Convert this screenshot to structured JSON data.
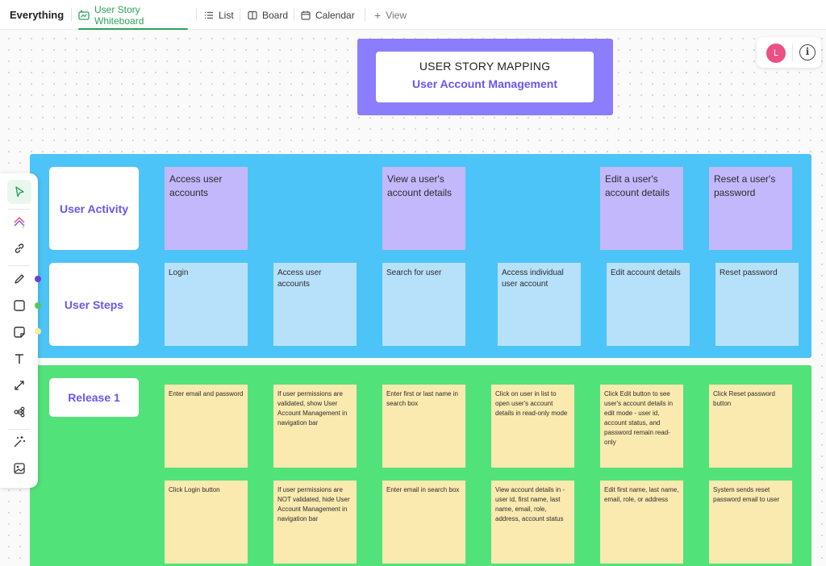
{
  "nav": {
    "breadcrumb": "Everything",
    "tabs": [
      {
        "label": "User Story Whiteboard",
        "icon": "whiteboard-icon",
        "active": true
      },
      {
        "label": "List",
        "icon": "list-icon"
      },
      {
        "label": "Board",
        "icon": "board-icon"
      },
      {
        "label": "Calendar",
        "icon": "calendar-icon"
      },
      {
        "label": "View",
        "icon": "plus-icon"
      }
    ]
  },
  "header_card": {
    "title": "USER STORY MAPPING",
    "subtitle": "User Account Management"
  },
  "user": {
    "avatar_initial": "L",
    "avatar_color": "#ec4f84",
    "info_symbol": "i"
  },
  "colors": {
    "accent": "#2aa45a",
    "title_card": "#8b7dfb",
    "lane_blue": "#4cc4f7",
    "lane_green": "#52e27a",
    "sticky_purple": "#c3b8fb",
    "sticky_blue": "#b7e1fb",
    "sticky_yellow": "#faeab0",
    "label_text": "#6b55f0"
  },
  "rows": {
    "activity": {
      "label": "User Activity",
      "items": [
        "Access user accounts",
        "View a user's account details",
        "Edit a user's account details",
        "Reset a user's password"
      ]
    },
    "steps": {
      "label": "User Steps",
      "items": [
        "Login",
        "Access user accounts",
        "Search for user",
        "Access individual user account",
        "Edit account details",
        "Reset password"
      ]
    },
    "release": {
      "label": "Release 1",
      "row1": [
        "Enter email and password",
        "If user permissions are validated, show User Account Management in navigation bar",
        "Enter first or last name in search box",
        "Click on user in list to open user's account details in read-only mode",
        "Click Edit button to see user's account details in edit mode - user id, account status, and password remain read-only",
        "Click Reset password button"
      ],
      "row2": [
        "Click Login button",
        "If user permissions are NOT validated, hide User Account Management in navigation bar",
        "Enter email in search box",
        "View account details in - user id, first name, last name, email, role, address, account status",
        "Edit first name, last name, email, role, or address",
        "System sends reset password email to user"
      ]
    }
  },
  "toolbar": {
    "tools": [
      "cursor-icon",
      "ai-shapes-icon",
      "link-icon",
      "pen-icon",
      "rectangle-icon",
      "sticky-note-icon",
      "text-icon",
      "connector-icon",
      "mindmap-icon",
      "magic-icon",
      "image-icon"
    ],
    "pen_colors": [
      "#6b3fd8",
      "#52c95f",
      "#f3ec9c"
    ]
  }
}
